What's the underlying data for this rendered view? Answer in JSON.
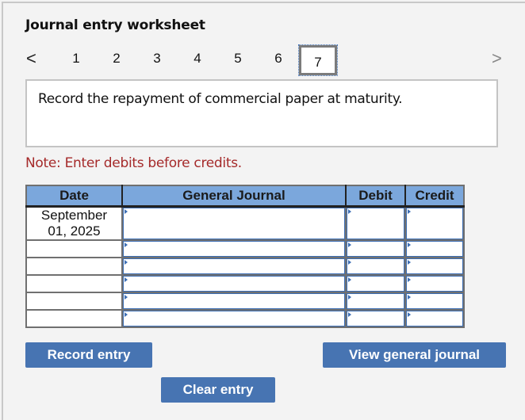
{
  "worksheet": {
    "title": "Journal entry worksheet",
    "nav": {
      "prev_icon": "chevron-left-icon",
      "next_icon": "chevron-right-icon",
      "prev_glyph": "<",
      "next_glyph": ">",
      "pages": [
        "1",
        "2",
        "3",
        "4",
        "5",
        "6",
        "7"
      ],
      "active_page": "7"
    },
    "prompt": "Record the repayment of commercial paper at maturity.",
    "note": "Note: Enter debits before credits.",
    "table": {
      "headers": [
        "Date",
        "General Journal",
        "Debit",
        "Credit"
      ],
      "rows": [
        {
          "date_line1": "September",
          "date_line2": "01, 2025",
          "account": "",
          "debit": "",
          "credit": ""
        },
        {
          "date_line1": "",
          "date_line2": "",
          "account": "",
          "debit": "",
          "credit": ""
        },
        {
          "date_line1": "",
          "date_line2": "",
          "account": "",
          "debit": "",
          "credit": ""
        },
        {
          "date_line1": "",
          "date_line2": "",
          "account": "",
          "debit": "",
          "credit": ""
        },
        {
          "date_line1": "",
          "date_line2": "",
          "account": "",
          "debit": "",
          "credit": ""
        },
        {
          "date_line1": "",
          "date_line2": "",
          "account": "",
          "debit": "",
          "credit": ""
        }
      ]
    },
    "buttons": {
      "record": "Record entry",
      "clear": "Clear entry",
      "view": "View general journal"
    },
    "colors": {
      "accent": "#4774b2",
      "header_bg": "#7ba7dc",
      "note": "#a52a2a"
    }
  }
}
